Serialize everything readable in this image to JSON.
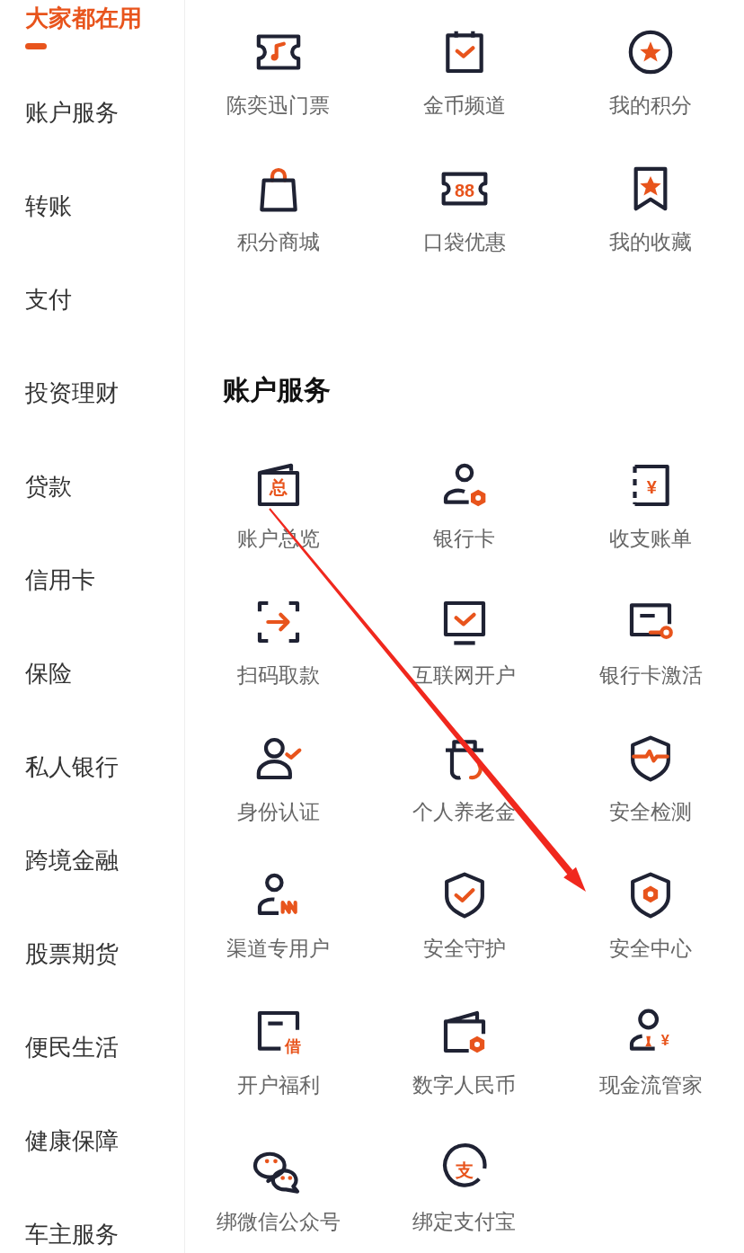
{
  "sidebar": {
    "items": [
      {
        "label": "大家都在用",
        "selected": true
      },
      {
        "label": "账户服务",
        "selected": false
      },
      {
        "label": "转账",
        "selected": false
      },
      {
        "label": "支付",
        "selected": false
      },
      {
        "label": "投资理财",
        "selected": false
      },
      {
        "label": "贷款",
        "selected": false
      },
      {
        "label": "信用卡",
        "selected": false
      },
      {
        "label": "保险",
        "selected": false
      },
      {
        "label": "私人银行",
        "selected": false
      },
      {
        "label": "跨境金融",
        "selected": false
      },
      {
        "label": "股票期货",
        "selected": false
      },
      {
        "label": "便民生活",
        "selected": false
      },
      {
        "label": "健康保障",
        "selected": false
      },
      {
        "label": "车主服务",
        "selected": false
      }
    ]
  },
  "sections": [
    {
      "items": [
        {
          "label": "陈奕迅门票",
          "kind": "ticket"
        },
        {
          "label": "金币频道",
          "kind": "calendar-check"
        },
        {
          "label": "我的积分",
          "kind": "star-circle"
        },
        {
          "label": "积分商城",
          "kind": "bag"
        },
        {
          "label": "口袋优惠",
          "kind": "coupon",
          "icon_text": "88"
        },
        {
          "label": "我的收藏",
          "kind": "bookmark"
        }
      ]
    },
    {
      "title": "账户服务",
      "items": [
        {
          "label": "账户总览",
          "kind": "wallet-text",
          "icon_text": "总"
        },
        {
          "label": "银行卡",
          "kind": "person-hex"
        },
        {
          "label": "收支账单",
          "kind": "ledger",
          "icon_text": "¥"
        },
        {
          "label": "扫码取款",
          "kind": "scan"
        },
        {
          "label": "互联网开户",
          "kind": "monitor"
        },
        {
          "label": "银行卡激活",
          "kind": "card-key"
        },
        {
          "label": "身份认证",
          "kind": "person-check"
        },
        {
          "label": "个人养老金",
          "kind": "pension"
        },
        {
          "label": "安全检测",
          "kind": "shield-pulse"
        },
        {
          "label": "渠道专用户",
          "kind": "person-wave"
        },
        {
          "label": "安全守护",
          "kind": "shield-check"
        },
        {
          "label": "安全中心",
          "kind": "shield-hex"
        },
        {
          "label": "开户福利",
          "kind": "card-text",
          "icon_text": "借"
        },
        {
          "label": "数字人民币",
          "kind": "wallet-hex"
        },
        {
          "label": "现金流管家",
          "kind": "person-tie",
          "icon_text": "¥"
        },
        {
          "label": "绑微信公众号",
          "kind": "chat"
        },
        {
          "label": "绑定支付宝",
          "kind": "circle-text",
          "icon_text": "支"
        }
      ]
    }
  ],
  "annotation_arrow": true
}
